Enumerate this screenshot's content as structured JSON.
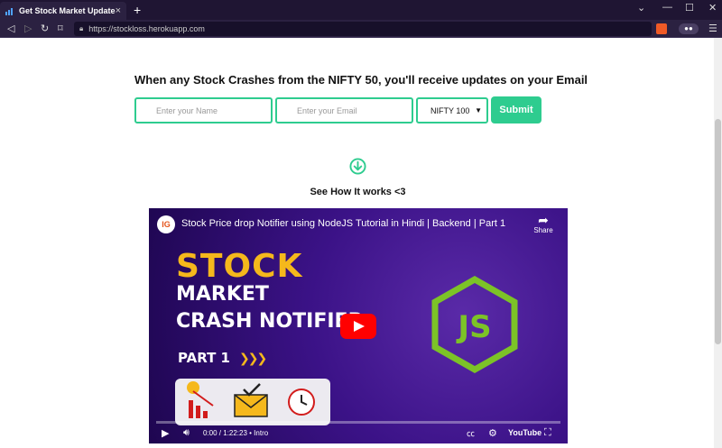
{
  "browser": {
    "tab_title": "Get Stock Market Updates",
    "tab_close": "×",
    "new_tab": "+",
    "url": "https://stockloss.herokuapp.com",
    "window_controls": [
      "⌄",
      "—",
      "☐",
      "✕"
    ]
  },
  "page": {
    "headline": "When any Stock Crashes from the NIFTY 50, you'll receive updates on your Email",
    "form": {
      "name_placeholder": "Enter your Name",
      "email_placeholder": "Enter your Email",
      "index_selected": "NIFTY 100",
      "submit_label": "Submit"
    },
    "how_it_works": "See How It works <3"
  },
  "video": {
    "title": "Stock Price drop Notifier using NodeJS Tutorial in Hindi | Backend | Part 1",
    "channel_initials": "IG",
    "share_label": "Share",
    "thumb_line1": "STOCK",
    "thumb_line2": "MARKET",
    "thumb_line3": "CRASH NOTIFIER",
    "thumb_part": "PART 1",
    "time": "0:00 / 1:22:23 • Intro",
    "brand": "YouTube"
  },
  "colors": {
    "accent": "#2ecc8f",
    "browser_bg": "#2b2141",
    "video_bg": "#3b1287",
    "thumb_gold": "#f5b81c",
    "node_green": "#7cc327"
  }
}
